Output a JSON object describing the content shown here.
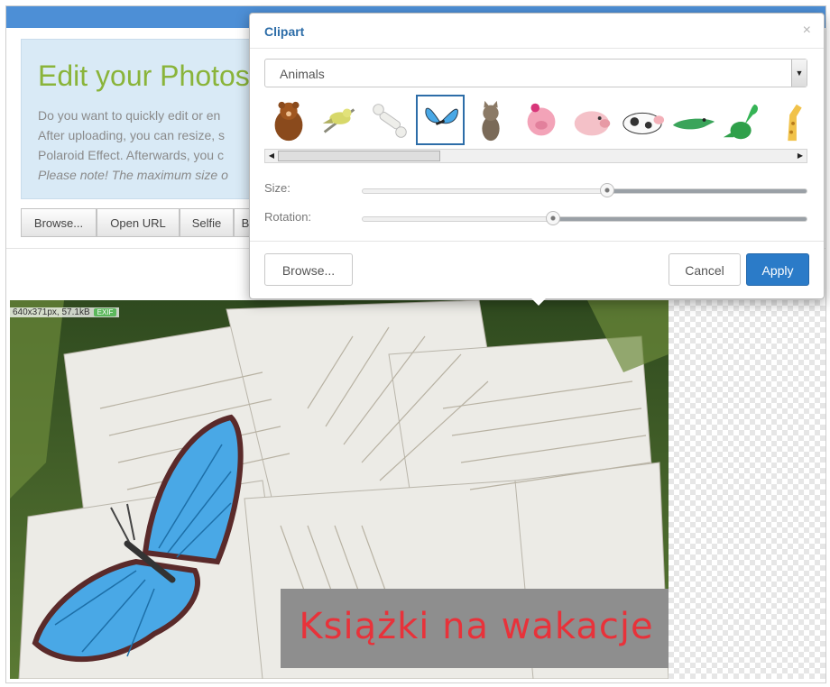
{
  "intro": {
    "title": "Edit your Photos",
    "line1": "Do you want to quickly edit or en",
    "line2": "After uploading, you can resize, s",
    "line3": "Polaroid Effect. Afterwards, you c",
    "line4": "Please note! The maximum size o"
  },
  "toolbar": {
    "browse": "Browse...",
    "open_url": "Open URL",
    "selfie": "Selfie",
    "more": "B"
  },
  "image_info": {
    "text": "640x371px, 57.1kB",
    "badge": "EXIF"
  },
  "photo": {
    "caption": "Książki na wakacje"
  },
  "dialog": {
    "title": "Clipart",
    "close": "×",
    "category": "Animals",
    "clips": [
      "bear-icon",
      "bird-icon",
      "bone-icon",
      "butterfly-icon",
      "cat-icon",
      "pig-girl-icon",
      "pig-icon",
      "cow-icon",
      "crocodile-icon",
      "dinosaur-icon",
      "giraffe-icon"
    ],
    "selected_clip": "butterfly-icon",
    "size_label": "Size:",
    "size_value": 0.55,
    "rotation_label": "Rotation:",
    "rotation_value": 0.43,
    "browse": "Browse...",
    "cancel": "Cancel",
    "apply": "Apply"
  },
  "colors": {
    "accent": "#2b7bc8",
    "title_green": "#8ab43a",
    "caption_red": "#e8323a"
  }
}
